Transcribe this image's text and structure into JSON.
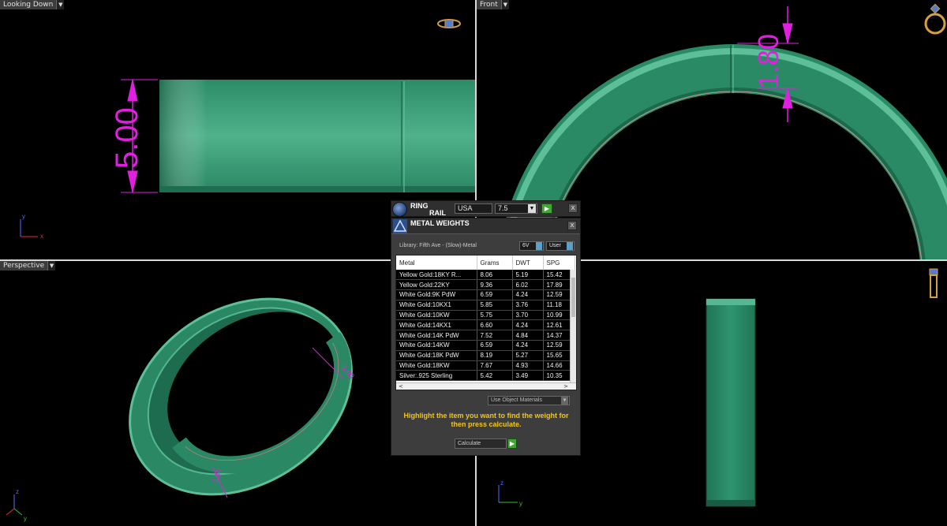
{
  "viewports": {
    "top_left": {
      "label": "Looking Down",
      "dimension": "5.00"
    },
    "top_right": {
      "label": "Front",
      "dimension": "1.80"
    },
    "bottom_left": {
      "label": "Perspective",
      "dimension_a": "5.00",
      "dimension_b": "1.80"
    },
    "bottom_right": {
      "label": ""
    }
  },
  "axes": {
    "x": "x",
    "y": "y",
    "z": "z"
  },
  "ring_rail": {
    "title_line1": "RING",
    "title_line2": "RAIL",
    "region": "USA",
    "size": "7.5",
    "close": "x"
  },
  "metal_weights": {
    "title": "METAL WEIGHTS",
    "library_label": "Library: Fifth Ave - (Slow)-Metal",
    "toggle_1": "6V",
    "toggle_2": "User",
    "columns": [
      "Metal",
      "Grams",
      "DWT",
      "SPG"
    ],
    "rows": [
      [
        "Yellow Gold:18KY R...",
        "8.06",
        "5.19",
        "15.42"
      ],
      [
        "Yellow Gold:22KY",
        "9.36",
        "6.02",
        "17.89"
      ],
      [
        "White Gold:9K PdW",
        "6.59",
        "4.24",
        "12.59"
      ],
      [
        "White Gold:10KX1",
        "5.85",
        "3.76",
        "11.18"
      ],
      [
        "White Gold:10KW",
        "5.75",
        "3.70",
        "10.99"
      ],
      [
        "White Gold:14KX1",
        "6.60",
        "4.24",
        "12.61"
      ],
      [
        "White Gold:14K PdW",
        "7.52",
        "4.84",
        "14.37"
      ],
      [
        "White Gold:14KW",
        "6.59",
        "4.24",
        "12.59"
      ],
      [
        "White Gold:18K PdW",
        "8.19",
        "5.27",
        "15.65"
      ],
      [
        "White Gold:18KW",
        "7.67",
        "4.93",
        "14.66"
      ],
      [
        "Silver:.925 Sterling",
        "5.42",
        "3.49",
        "10.35"
      ]
    ],
    "materials_select": "Use Object Materials",
    "hint": "Highlight the item you want to find the weight for then press calculate.",
    "calculate": "Calculate"
  },
  "colors": {
    "ring": "#2f8f6c",
    "dimension": "#e21fe0",
    "hint": "#f2c51b"
  }
}
